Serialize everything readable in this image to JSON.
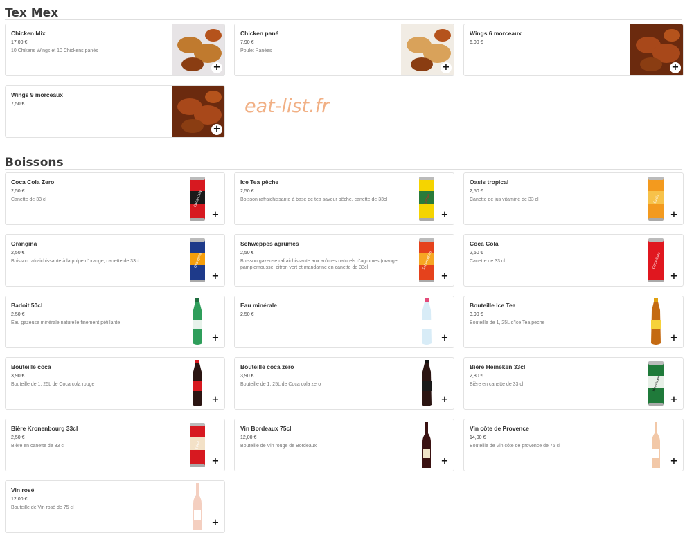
{
  "watermark": "eat-list.fr",
  "sections": [
    {
      "title": "Tex Mex",
      "items": [
        {
          "name": "Chicken Mix",
          "price": "17,00 €",
          "desc": "10 Chikens Wings et 10 Chickens panés",
          "image": "fried-chicken-mix-photo"
        },
        {
          "name": "Chicken pané",
          "price": "7,90 €",
          "desc": "Poulet Panées",
          "image": "breaded-chicken-photo"
        },
        {
          "name": "Wings 6 morceaux",
          "price": "6,00 €",
          "desc": "",
          "image": "chicken-wings-photo"
        },
        {
          "name": "Wings 9 morceaux",
          "price": "7,50 €",
          "desc": "",
          "image": "chicken-wings-photo"
        }
      ]
    },
    {
      "title": "Boissons",
      "items": [
        {
          "name": "Coca Cola Zero",
          "price": "2,50 €",
          "desc": "Canette de 33 cl",
          "image": "coca-zero-can"
        },
        {
          "name": "Ice Tea pêche",
          "price": "2,50 €",
          "desc": "Boisson rafraichissante à base de tea saveur pêche, canette de 33cl",
          "image": "lipton-can"
        },
        {
          "name": "Oasis tropical",
          "price": "2,50 €",
          "desc": "Canette de jus vitaminé de 33 cl",
          "image": "oasis-can"
        },
        {
          "name": "Orangina",
          "price": "2,50 €",
          "desc": "Boisson rafraichissante à la pulpe d'orange, canette de 33cl",
          "image": "orangina-can"
        },
        {
          "name": "Schweppes agrumes",
          "price": "2,50 €",
          "desc": "Boisson gazeuse rafraichissante aux arômes naturels d'agrumes (orange, pamplemousse, citron vert et mandarine en canette de 33cl",
          "image": "schweppes-can"
        },
        {
          "name": "Coca Cola",
          "price": "2,50 €",
          "desc": "Canette de 33 cl",
          "image": "coca-can"
        },
        {
          "name": "Badoit 50cl",
          "price": "2,50 €",
          "desc": "Eau gazeuse minérale naturelle finement pétillante",
          "image": "badoit-bottle"
        },
        {
          "name": "Eau minérale",
          "price": "2,50 €",
          "desc": "",
          "image": "evian-bottle"
        },
        {
          "name": "Bouteille Ice Tea",
          "price": "3,90 €",
          "desc": "Bouteille de 1, 25L d'Ice Tea peche",
          "image": "icetea-bottle"
        },
        {
          "name": "Bouteille coca",
          "price": "3,90 €",
          "desc": "Bouteille de 1, 25L de Coca cola rouge",
          "image": "coca-bottle"
        },
        {
          "name": "Bouteille coca zero",
          "price": "3,90 €",
          "desc": "Bouteille de 1, 25L de Coca cola zero",
          "image": "coca-zero-bottle"
        },
        {
          "name": "Bière Heineken 33cl",
          "price": "2,80 €",
          "desc": "Bière en canette de 33 cl",
          "image": "heineken-can"
        },
        {
          "name": "Bière Kronenbourg 33cl",
          "price": "2,50 €",
          "desc": "Bière en canette de 33 cl",
          "image": "kronenbourg-can"
        },
        {
          "name": "Vin Bordeaux 75cl",
          "price": "12,00 €",
          "desc": "Bouteille de Vin rouge de Bordeaux",
          "image": "red-wine-bottle"
        },
        {
          "name": "Vin côte de Provence",
          "price": "14,00 €",
          "desc": "Bouteille de Vin côte de provence de 75 cl",
          "image": "rose-wine-bottle"
        },
        {
          "name": "Vin rosé",
          "price": "12,00 €",
          "desc": "Bouteille de Vin rosé de 75 cl",
          "image": "rose-wine-bottle-light"
        }
      ]
    }
  ],
  "add_label": "+",
  "colors": {
    "watermark": "#f0a878",
    "border": "#e2e2e2"
  }
}
